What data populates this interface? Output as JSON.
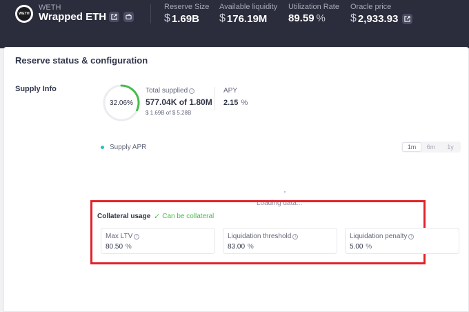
{
  "header": {
    "logo_text": "WETH",
    "symbol": "WETH",
    "name": "Wrapped ETH",
    "icons": [
      "external-link-icon",
      "wallet-icon"
    ],
    "stats": [
      {
        "label": "Reserve Size",
        "prefix": "$",
        "value": "1.69B",
        "suffix": ""
      },
      {
        "label": "Available liquidity",
        "prefix": "$",
        "value": "176.19M",
        "suffix": ""
      },
      {
        "label": "Utilization Rate",
        "prefix": "",
        "value": "89.59",
        "suffix": "%"
      },
      {
        "label": "Oracle price",
        "prefix": "$",
        "value": "2,933.93",
        "suffix": ""
      }
    ]
  },
  "card": {
    "title": "Reserve status & configuration",
    "supply": {
      "section_label": "Supply Info",
      "ring_percent_text": "32.06%",
      "ring_fraction": 0.3206,
      "total_supplied_label": "Total supplied",
      "total_supplied_value": "577.04K of 1.80M",
      "total_supplied_usd": "$ 1.69B of $ 5.28B",
      "apy_label": "APY",
      "apy_value": "2.15",
      "apy_unit": "%"
    },
    "chart": {
      "legend_label": "Supply APR",
      "periods": [
        "1m",
        "6m",
        "1y"
      ],
      "active_period": "1m",
      "loading_text": "Loading data..."
    },
    "collateral": {
      "label": "Collateral usage",
      "status": "Can be collateral",
      "metrics": [
        {
          "label": "Max LTV",
          "value": "80.50",
          "unit": "%"
        },
        {
          "label": "Liquidation threshold",
          "value": "83.00",
          "unit": "%"
        },
        {
          "label": "Liquidation penalty",
          "value": "5.00",
          "unit": "%"
        }
      ]
    }
  },
  "colors": {
    "header_bg": "#2b2d3c",
    "ring_green": "#46bc4b",
    "legend_teal": "#2ebac6",
    "highlight_red": "#e3212a",
    "check_green": "#46bc4b"
  }
}
